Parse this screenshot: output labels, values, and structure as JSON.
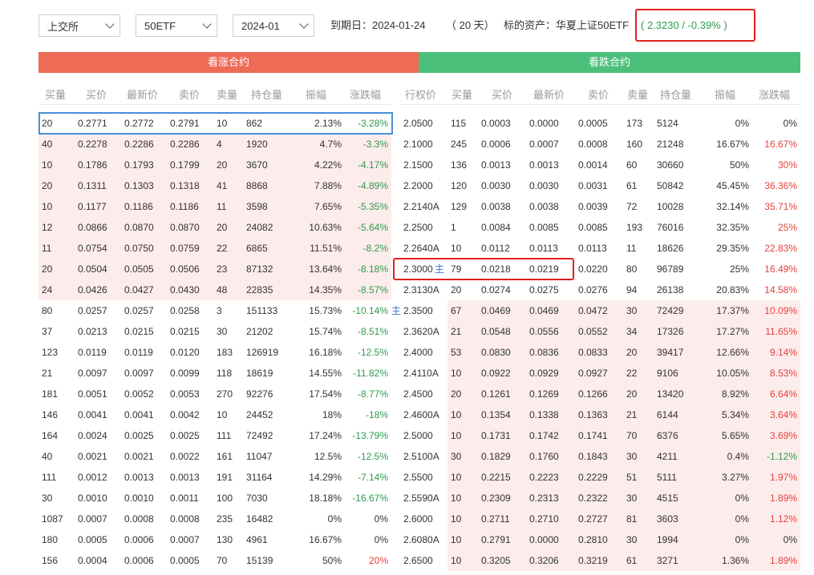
{
  "filters": {
    "exchange": "上交所",
    "underlying": "50ETF",
    "month": "2024-01"
  },
  "info": {
    "expiry": "到期日：2024-01-24",
    "days": "（ 20 天）",
    "asset_label": "标的资产：华夏上证50ETF",
    "price": "( 2.3230 / -0.39% )"
  },
  "banners": {
    "call": "看涨合约",
    "put": "看跌合约"
  },
  "headers": {
    "call": [
      "买量",
      "买价",
      "最新价",
      "卖价",
      "卖量",
      "持仓量",
      "振幅",
      "涨跌幅"
    ],
    "strike": "行权价",
    "put": [
      "买量",
      "买价",
      "最新价",
      "卖价",
      "卖量",
      "持仓量",
      "振幅",
      "涨跌幅"
    ]
  },
  "main_marker": "主",
  "colors": {
    "call_banner": "#ee6b55",
    "put_banner": "#4cc07a",
    "itm_bg": "#fdecec",
    "up": "#e8413b",
    "down": "#2e9a4e"
  },
  "rows": [
    {
      "call": [
        "20",
        "0.2771",
        "0.2772",
        "0.2791",
        "10",
        "862",
        "2.13%",
        "-3.28%"
      ],
      "strike": "2.0500",
      "put": [
        "115",
        "0.0003",
        "0.0000",
        "0.0005",
        "173",
        "5124",
        "0%",
        "0%"
      ]
    },
    {
      "call": [
        "40",
        "0.2278",
        "0.2286",
        "0.2286",
        "4",
        "1920",
        "4.7%",
        "-3.3%"
      ],
      "strike": "2.1000",
      "put": [
        "245",
        "0.0006",
        "0.0007",
        "0.0008",
        "160",
        "21248",
        "16.67%",
        "16.67%"
      ]
    },
    {
      "call": [
        "10",
        "0.1786",
        "0.1793",
        "0.1799",
        "20",
        "3670",
        "4.22%",
        "-4.17%"
      ],
      "strike": "2.1500",
      "put": [
        "136",
        "0.0013",
        "0.0013",
        "0.0014",
        "60",
        "30660",
        "50%",
        "30%"
      ]
    },
    {
      "call": [
        "20",
        "0.1311",
        "0.1303",
        "0.1318",
        "41",
        "8868",
        "7.88%",
        "-4.89%"
      ],
      "strike": "2.2000",
      "put": [
        "120",
        "0.0030",
        "0.0030",
        "0.0031",
        "61",
        "50842",
        "45.45%",
        "36.36%"
      ]
    },
    {
      "call": [
        "10",
        "0.1177",
        "0.1186",
        "0.1186",
        "11",
        "3598",
        "7.65%",
        "-5.35%"
      ],
      "strike": "2.2140A",
      "put": [
        "129",
        "0.0038",
        "0.0038",
        "0.0039",
        "72",
        "10028",
        "32.14%",
        "35.71%"
      ]
    },
    {
      "call": [
        "12",
        "0.0866",
        "0.0870",
        "0.0870",
        "20",
        "24082",
        "10.63%",
        "-5.64%"
      ],
      "strike": "2.2500",
      "put": [
        "1",
        "0.0084",
        "0.0085",
        "0.0085",
        "193",
        "76016",
        "32.35%",
        "25%"
      ]
    },
    {
      "call": [
        "11",
        "0.0754",
        "0.0750",
        "0.0759",
        "22",
        "6865",
        "11.51%",
        "-8.2%"
      ],
      "strike": "2.2640A",
      "put": [
        "10",
        "0.0112",
        "0.0113",
        "0.0113",
        "11",
        "18626",
        "29.35%",
        "22.83%"
      ]
    },
    {
      "call": [
        "20",
        "0.0504",
        "0.0505",
        "0.0506",
        "23",
        "87132",
        "13.64%",
        "-8.18%"
      ],
      "strike": "2.3000",
      "put": [
        "79",
        "0.0218",
        "0.0219",
        "0.0220",
        "80",
        "96789",
        "25%",
        "16.49%"
      ]
    },
    {
      "call": [
        "24",
        "0.0426",
        "0.0427",
        "0.0430",
        "48",
        "22835",
        "14.35%",
        "-8.57%"
      ],
      "strike": "2.3130A",
      "put": [
        "20",
        "0.0274",
        "0.0275",
        "0.0276",
        "94",
        "26138",
        "20.83%",
        "14.58%"
      ]
    },
    {
      "call": [
        "80",
        "0.0257",
        "0.0257",
        "0.0258",
        "3",
        "151133",
        "15.73%",
        "-10.14%"
      ],
      "strike": "2.3500",
      "put": [
        "67",
        "0.0469",
        "0.0469",
        "0.0472",
        "30",
        "72429",
        "17.37%",
        "10.09%"
      ]
    },
    {
      "call": [
        "37",
        "0.0213",
        "0.0215",
        "0.0215",
        "30",
        "21202",
        "15.74%",
        "-8.51%"
      ],
      "strike": "2.3620A",
      "put": [
        "21",
        "0.0548",
        "0.0556",
        "0.0552",
        "34",
        "17326",
        "17.27%",
        "11.65%"
      ]
    },
    {
      "call": [
        "123",
        "0.0119",
        "0.0119",
        "0.0120",
        "183",
        "126919",
        "16.18%",
        "-12.5%"
      ],
      "strike": "2.4000",
      "put": [
        "53",
        "0.0830",
        "0.0836",
        "0.0833",
        "20",
        "39417",
        "12.66%",
        "9.14%"
      ]
    },
    {
      "call": [
        "21",
        "0.0097",
        "0.0097",
        "0.0099",
        "118",
        "18619",
        "14.55%",
        "-11.82%"
      ],
      "strike": "2.4110A",
      "put": [
        "10",
        "0.0922",
        "0.0929",
        "0.0927",
        "22",
        "9106",
        "10.05%",
        "8.53%"
      ]
    },
    {
      "call": [
        "181",
        "0.0051",
        "0.0052",
        "0.0053",
        "270",
        "92276",
        "17.54%",
        "-8.77%"
      ],
      "strike": "2.4500",
      "put": [
        "20",
        "0.1261",
        "0.1269",
        "0.1266",
        "20",
        "13420",
        "8.92%",
        "6.64%"
      ]
    },
    {
      "call": [
        "146",
        "0.0041",
        "0.0041",
        "0.0042",
        "10",
        "24452",
        "18%",
        "-18%"
      ],
      "strike": "2.4600A",
      "put": [
        "10",
        "0.1354",
        "0.1338",
        "0.1363",
        "21",
        "6144",
        "5.34%",
        "3.64%"
      ]
    },
    {
      "call": [
        "164",
        "0.0024",
        "0.0025",
        "0.0025",
        "111",
        "72492",
        "17.24%",
        "-13.79%"
      ],
      "strike": "2.5000",
      "put": [
        "10",
        "0.1731",
        "0.1742",
        "0.1741",
        "70",
        "6376",
        "5.65%",
        "3.69%"
      ]
    },
    {
      "call": [
        "40",
        "0.0021",
        "0.0021",
        "0.0022",
        "161",
        "11047",
        "12.5%",
        "-12.5%"
      ],
      "strike": "2.5100A",
      "put": [
        "30",
        "0.1829",
        "0.1760",
        "0.1843",
        "30",
        "4211",
        "0.4%",
        "-1.12%"
      ]
    },
    {
      "call": [
        "111",
        "0.0012",
        "0.0013",
        "0.0013",
        "191",
        "31164",
        "14.29%",
        "-7.14%"
      ],
      "strike": "2.5500",
      "put": [
        "10",
        "0.2215",
        "0.2223",
        "0.2229",
        "51",
        "5111",
        "3.27%",
        "1.97%"
      ]
    },
    {
      "call": [
        "30",
        "0.0010",
        "0.0010",
        "0.0011",
        "100",
        "7030",
        "18.18%",
        "-16.67%"
      ],
      "strike": "2.5590A",
      "put": [
        "10",
        "0.2309",
        "0.2313",
        "0.2322",
        "30",
        "4515",
        "0%",
        "1.89%"
      ]
    },
    {
      "call": [
        "1087",
        "0.0007",
        "0.0008",
        "0.0008",
        "235",
        "16482",
        "0%",
        "0%"
      ],
      "strike": "2.6000",
      "put": [
        "10",
        "0.2711",
        "0.2710",
        "0.2727",
        "81",
        "3603",
        "0%",
        "1.12%"
      ]
    },
    {
      "call": [
        "180",
        "0.0005",
        "0.0006",
        "0.0007",
        "130",
        "4961",
        "16.67%",
        "0%"
      ],
      "strike": "2.6080A",
      "put": [
        "10",
        "0.2791",
        "0.0000",
        "0.2810",
        "30",
        "1994",
        "0%",
        "0%"
      ]
    },
    {
      "call": [
        "156",
        "0.0004",
        "0.0006",
        "0.0005",
        "70",
        "15139",
        "50%",
        "20%"
      ],
      "strike": "2.6500",
      "put": [
        "10",
        "0.3205",
        "0.3206",
        "0.3219",
        "61",
        "3271",
        "1.36%",
        "1.89%"
      ]
    }
  ]
}
